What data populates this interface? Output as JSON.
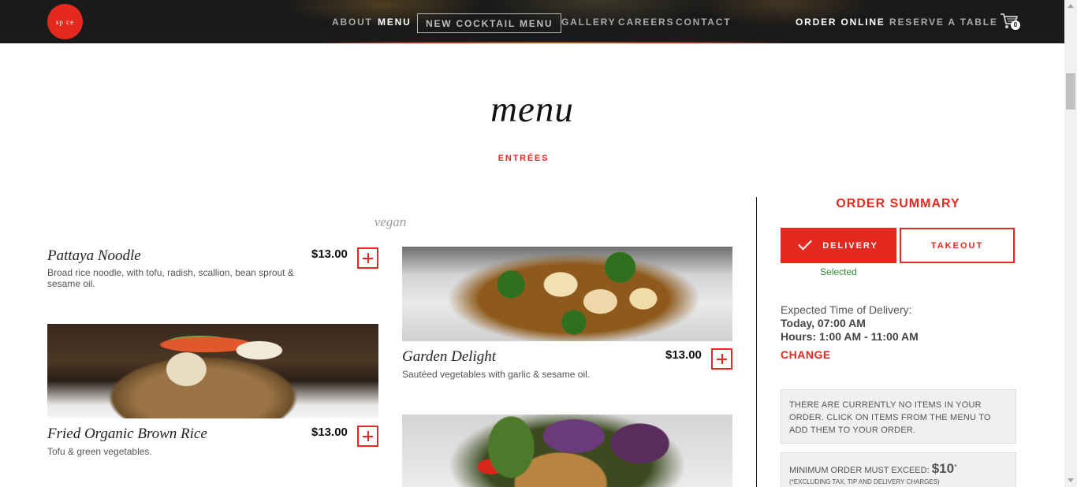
{
  "header": {
    "logo_text": "sp ce",
    "nav": {
      "about": "ABOUT",
      "menu": "MENU",
      "cocktail": "NEW COCKTAIL MENU",
      "gallery": "GALLERY",
      "careers": "CAREERS",
      "contact": "CONTACT",
      "order_online": "ORDER ONLINE",
      "reserve": "RESERVE A TABLE"
    },
    "cart_count": "0",
    "cart_icon": "cart-icon"
  },
  "page": {
    "title": "menu",
    "section": "ENTRÉES",
    "subsection": "vegan"
  },
  "items": [
    {
      "name": "Pattaya Noodle",
      "price": "$13.00",
      "description": "Broad rice noodle, with tofu, radish, scallion, bean sprout & sesame oil."
    },
    {
      "name": "Fried Organic Brown Rice",
      "price": "$13.00",
      "description": "Tofu & green vegetables."
    },
    {
      "name": "Garden Delight",
      "price": "$13.00",
      "description": "Sautéed vegetables with garlic & sesame oil."
    }
  ],
  "order_summary": {
    "title": "ORDER SUMMARY",
    "delivery_label": "DELIVERY",
    "takeout_label": "TAKEOUT",
    "selected_text": "Selected",
    "expected_label": "Expected Time of Delivery:",
    "expected_date": "Today, 07:00 AM",
    "hours_label": "Hours:",
    "hours_value": "1:00 AM - 11:00 AM",
    "change_label": "CHANGE",
    "empty_message": "THERE ARE CURRENTLY NO ITEMS IN YOUR ORDER. CLICK ON ITEMS FROM THE MENU TO ADD THEM TO YOUR ORDER.",
    "min_label": "MINIMUM ORDER MUST EXCEED:",
    "min_amount": "$10",
    "min_mark": "*",
    "min_note": "(*EXCLUDING TAX, TIP AND DELIVERY CHARGES)"
  },
  "colors": {
    "accent": "#e4291f",
    "selected": "#2e8b2e",
    "header_bg": "#1a1a1a"
  }
}
